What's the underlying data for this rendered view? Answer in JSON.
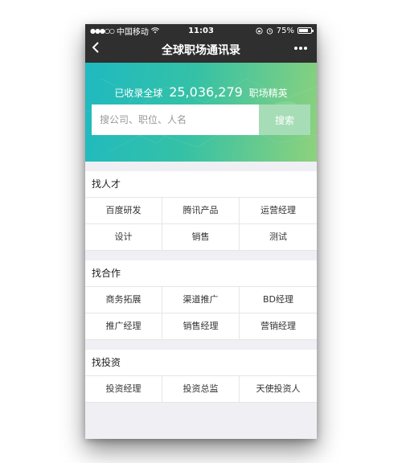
{
  "status_bar": {
    "carrier": "中国移动",
    "time": "11:03",
    "battery": "75%",
    "battery_level": 0.75
  },
  "nav": {
    "back_icon": "chevron-left-icon",
    "title": "全球职场通讯录",
    "more_icon": "more-icon"
  },
  "hero": {
    "prefix": "已收录全球",
    "count": "25,036,279",
    "suffix": "职场精英",
    "gradient_start": "#1fb9c1",
    "gradient_end": "#8ed27c"
  },
  "search": {
    "placeholder": "搜公司、职位、人名",
    "value": "",
    "button_label": "搜索",
    "button_color": "#a6ddb6"
  },
  "sections": [
    {
      "title": "找人才",
      "items": [
        "百度研发",
        "腾讯产品",
        "运营经理",
        "设计",
        "销售",
        "测试"
      ]
    },
    {
      "title": "找合作",
      "items": [
        "商务拓展",
        "渠道推广",
        "BD经理",
        "推广经理",
        "销售经理",
        "营销经理"
      ]
    },
    {
      "title": "找投资",
      "items": [
        "投资经理",
        "投资总监",
        "天使投资人"
      ]
    }
  ]
}
